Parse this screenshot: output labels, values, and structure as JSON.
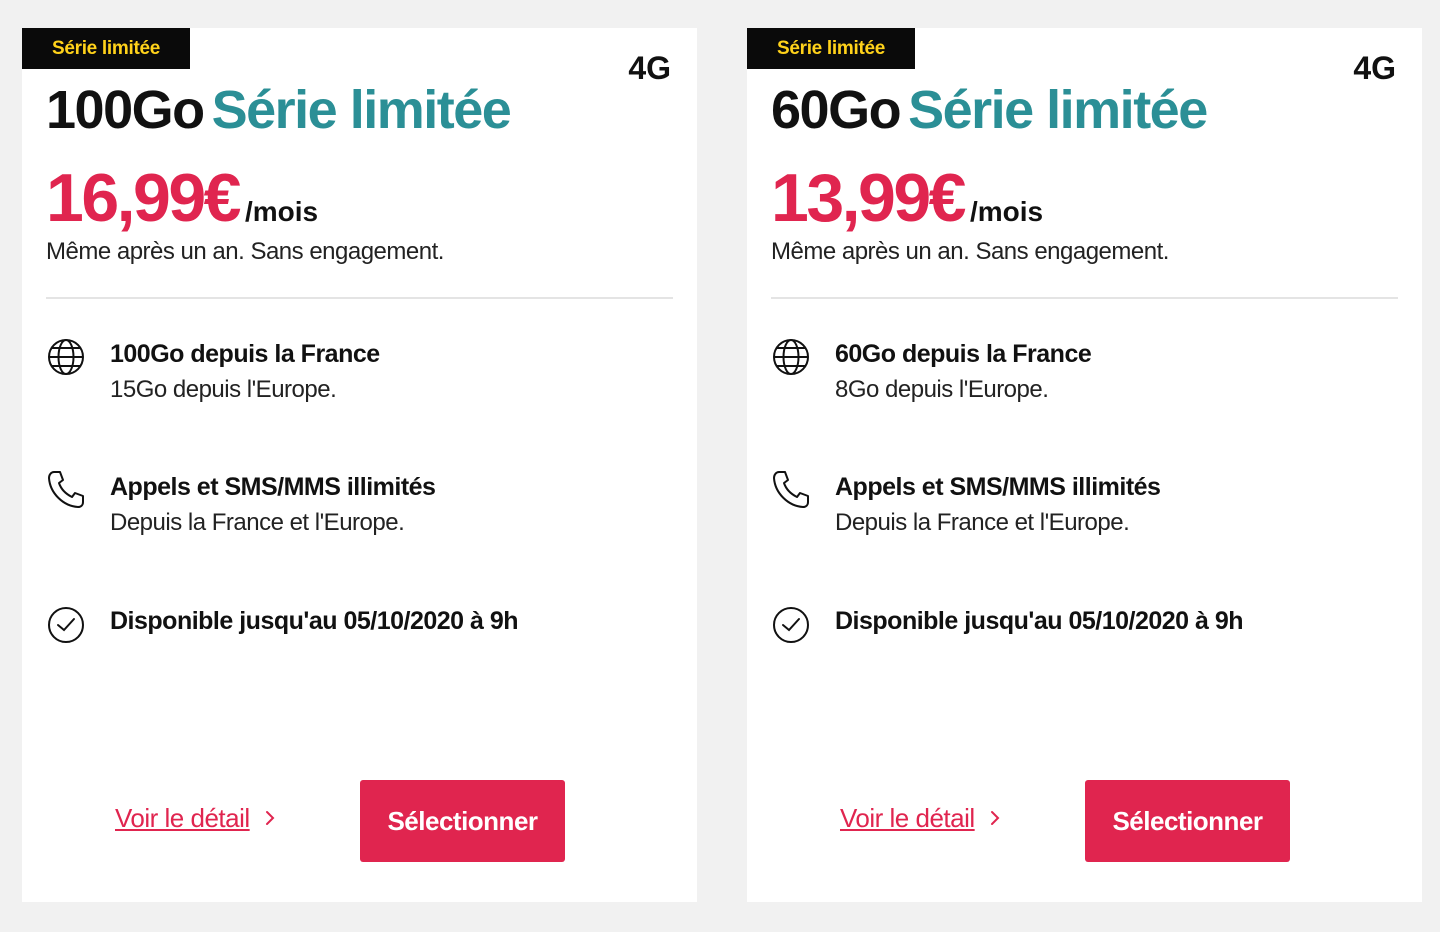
{
  "colors": {
    "accent": "#e0254f",
    "teal": "#2b8f96",
    "badge_bg": "#0a0a0a",
    "badge_text": "#ffd21a"
  },
  "cards": [
    {
      "badge": "Série limitée",
      "network": "4G",
      "title_data": "100Go",
      "title_series": "Série limitée",
      "price": "16,99€",
      "per": "/mois",
      "subtitle": "Même après un an. Sans engagement.",
      "features": [
        {
          "icon": "globe-icon",
          "title": "100Go depuis la France",
          "sub": "15Go depuis l'Europe."
        },
        {
          "icon": "phone-icon",
          "title": "Appels et SMS/MMS illimités",
          "sub": "Depuis la France et l'Europe."
        },
        {
          "icon": "clock-icon",
          "title": "Disponible jusqu'au 05/10/2020 à 9h",
          "sub": ""
        }
      ],
      "detail_link": "Voir le détail",
      "select_button": "Sélectionner"
    },
    {
      "badge": "Série limitée",
      "network": "4G",
      "title_data": "60Go",
      "title_series": "Série limitée",
      "price": "13,99€",
      "per": "/mois",
      "subtitle": "Même après un an. Sans engagement.",
      "features": [
        {
          "icon": "globe-icon",
          "title": "60Go depuis la France",
          "sub": "8Go depuis l'Europe."
        },
        {
          "icon": "phone-icon",
          "title": "Appels et SMS/MMS illimités",
          "sub": "Depuis la France et l'Europe."
        },
        {
          "icon": "clock-icon",
          "title": "Disponible jusqu'au 05/10/2020 à 9h",
          "sub": ""
        }
      ],
      "detail_link": "Voir le détail",
      "select_button": "Sélectionner"
    }
  ]
}
